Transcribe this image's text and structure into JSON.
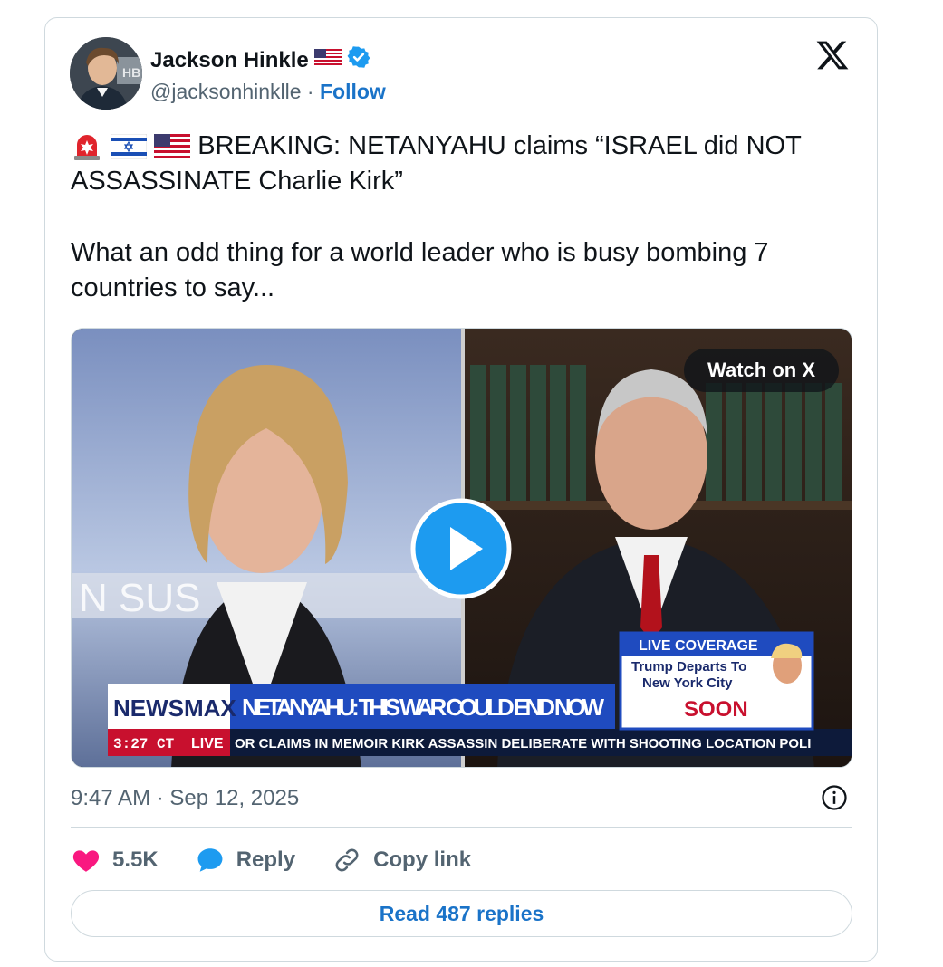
{
  "author": {
    "name": "Jackson Hinkle",
    "handle": "@jacksonhinklle",
    "separator": " · ",
    "follow_label": "Follow"
  },
  "tweet": {
    "line1_text": "BREAKING: NETANYAHU claims “ISRAEL did NOT ASSASSINATE Charlie Kirk”",
    "line2_text": "What an odd thing for a world leader who is busy bombing 7 countries to say..."
  },
  "media": {
    "watch_label": "Watch on X",
    "overlay": {
      "brand": "NEWSMAX",
      "headline": "NETANYAHU: THIS WAR COULD END NOW",
      "time": "3:27 CT",
      "live": "LIVE",
      "ticker": "OR CLAIMS IN MEMOIR      KIRK ASSASSIN DELIBERATE WITH SHOOTING LOCATION      POLI",
      "coverage_title": "LIVE COVERAGE",
      "coverage_text1": "Trump Departs To",
      "coverage_text2": "New York City",
      "coverage_soon": "SOON",
      "backdrop_text": "N SUS"
    }
  },
  "meta": {
    "timestamp": "9:47 AM · Sep 12, 2025"
  },
  "actions": {
    "likes": "5.5K",
    "reply_label": "Reply",
    "copy_label": "Copy link"
  },
  "read_replies_label": "Read 487 replies",
  "colors": {
    "accent": "#1a73c8",
    "like": "#f91880",
    "verified": "#1d9bf0"
  }
}
